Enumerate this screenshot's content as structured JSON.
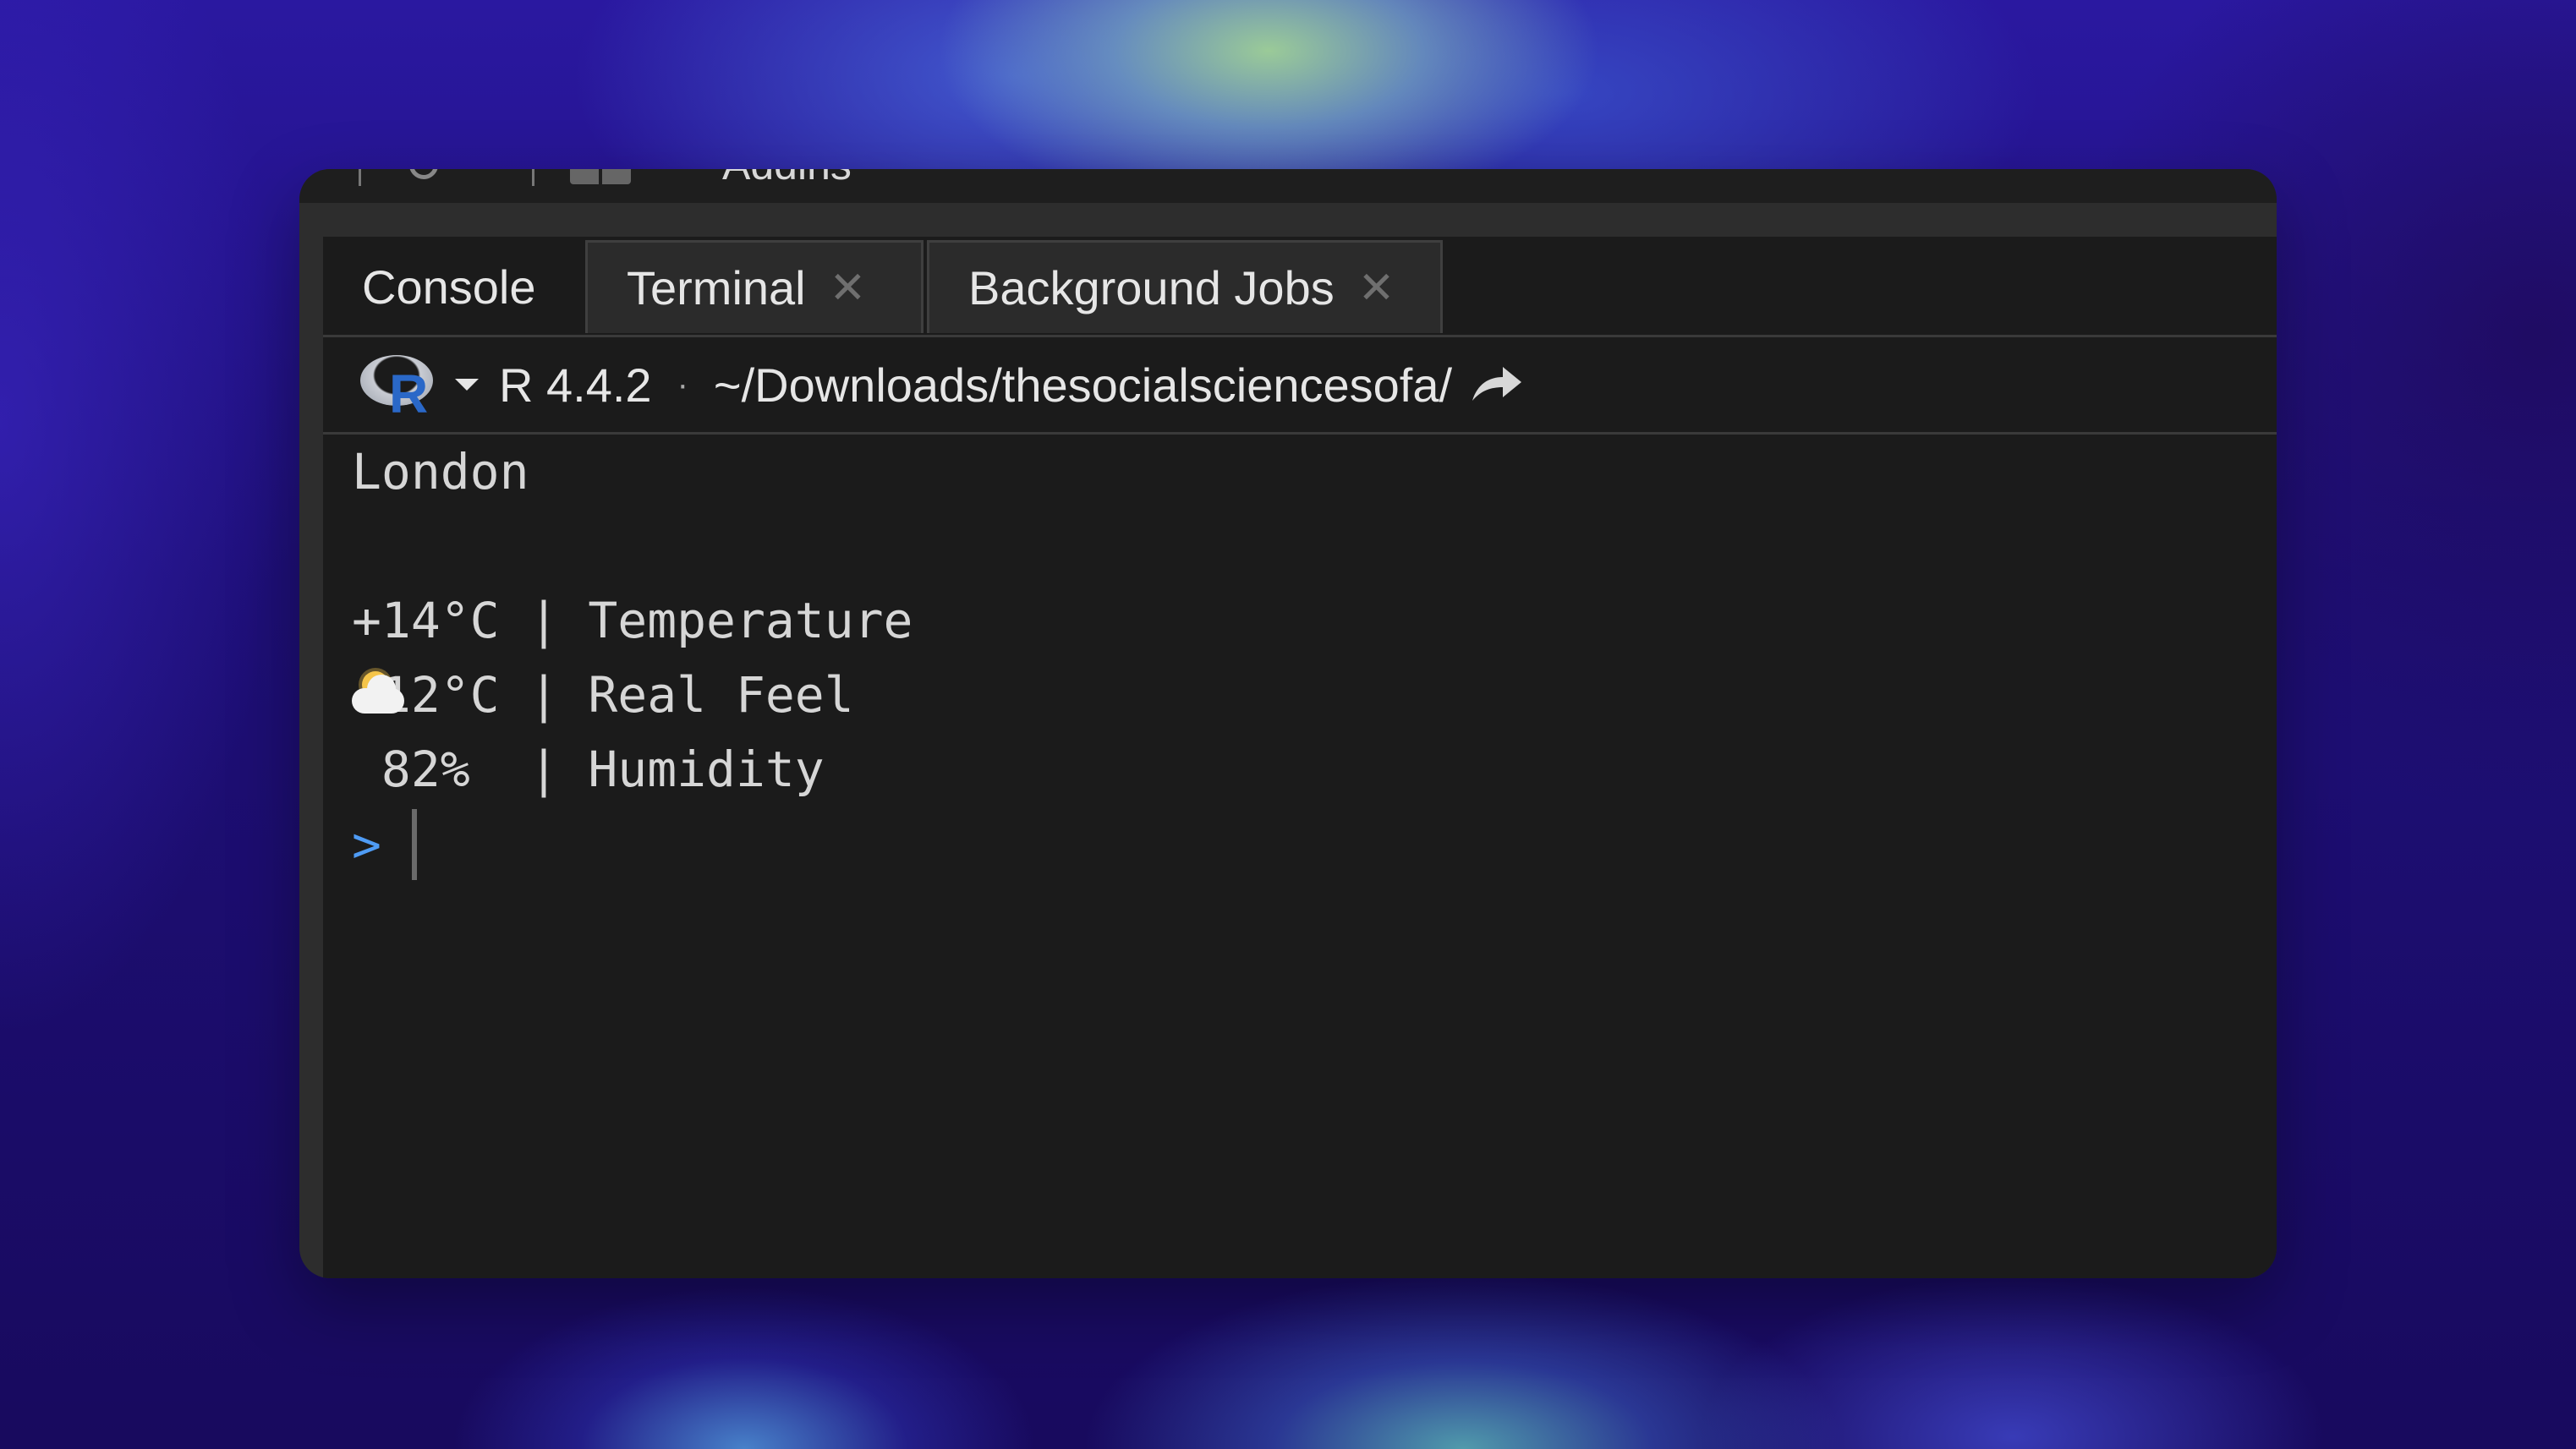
{
  "menubar": {
    "addins_label": "Addins",
    "icons": [
      "refresh-icon",
      "pane-layout-icon"
    ]
  },
  "tabs": [
    {
      "label": "Console",
      "active": true,
      "closable": false
    },
    {
      "label": "Terminal",
      "active": false,
      "closable": true
    },
    {
      "label": "Background Jobs",
      "active": false,
      "closable": true
    }
  ],
  "infobar": {
    "r_logo": "r-logo-icon",
    "version": "R 4.4.2",
    "separator": "·",
    "path": "~/Downloads/thesocialsciencesofa/",
    "path_action_icon": "share-arrow-icon"
  },
  "console": {
    "lines": [
      "London",
      "+14°C | Temperature",
      "+12°C | Real Feel",
      " 82%  | Humidity"
    ],
    "weather_icon": "sun-behind-cloud-icon",
    "prompt": ">"
  },
  "colors": {
    "pane_bg": "#1b1b1b",
    "text": "#d6d6d6",
    "prompt": "#4f9cf5",
    "r_blue": "#2a68c8"
  }
}
